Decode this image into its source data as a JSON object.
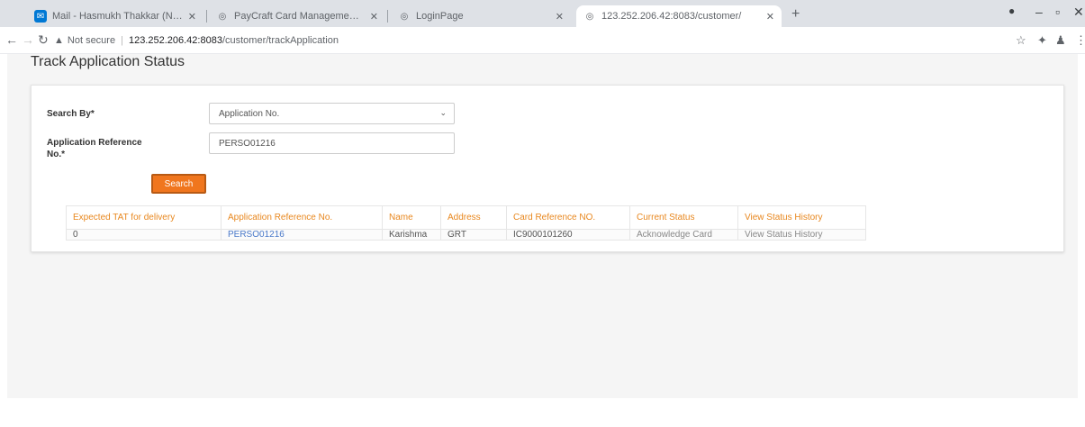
{
  "browser": {
    "tabs": [
      {
        "title": "Mail - Hasmukh Thakkar (NOS) -",
        "favicon": "outlook-icon",
        "favicon_color": "#0078d4",
        "active": false
      },
      {
        "title": "PayCraft Card Management Sys",
        "favicon": "globe-icon",
        "favicon_color": "#5f6368",
        "active": false
      },
      {
        "title": "LoginPage",
        "favicon": "globe-icon",
        "favicon_color": "#5f6368",
        "active": false
      },
      {
        "title": "123.252.206.42:8083/customer/",
        "favicon": "globe-icon",
        "favicon_color": "#5f6368",
        "active": true
      }
    ],
    "address": {
      "security_label": "Not secure",
      "host": "123.252.206.42:8083",
      "path": "/customer/trackApplication"
    }
  },
  "page": {
    "title": "Track Application Status",
    "form": {
      "search_by_label": "Search By",
      "search_by_value": "Application No.",
      "reference_label_line1": "Application Reference",
      "reference_label_line2": "No.",
      "reference_value": "PERSO01216",
      "required_mark": "*",
      "search_button": "Search"
    },
    "table": {
      "headers": [
        "Expected TAT for delivery",
        "Application Reference No.",
        "Name",
        "Address",
        "Card Reference NO.",
        "Current Status",
        "View Status History"
      ],
      "rows": [
        [
          "0",
          "PERSO01216",
          "Karishma",
          "GRT",
          "IC9000101260",
          "Acknowledge Card",
          "View Status History"
        ]
      ]
    }
  },
  "colors": {
    "accent": "#f0761e",
    "header_text": "#e8871e",
    "link": "#4a79c9"
  }
}
